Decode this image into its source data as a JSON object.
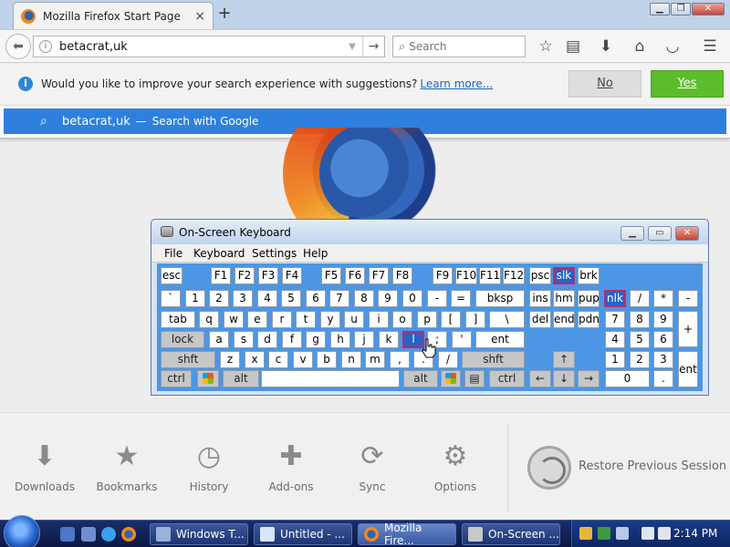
{
  "browser": {
    "tab_title": "Mozilla Firefox Start Page",
    "tab_close": "×",
    "new_tab": "+",
    "url": "betacrat,uk",
    "search_placeholder": "Search"
  },
  "notification": {
    "message": "Would you like to improve your search experience with suggestions?",
    "learn_more": "Learn more...",
    "no_label": "No",
    "yes_label": "Yes"
  },
  "suggestion": {
    "query": "betacrat,uk",
    "dash": "—",
    "action": "Search with Google"
  },
  "osk": {
    "title": "On-Screen Keyboard",
    "menu": [
      "File",
      "Keyboard",
      "Settings",
      "Help"
    ],
    "keys": {
      "esc": "esc",
      "f1": "F1",
      "f2": "F2",
      "f3": "F3",
      "f4": "F4",
      "f5": "F5",
      "f6": "F6",
      "f7": "F7",
      "f8": "F8",
      "f9": "F9",
      "f10": "F10",
      "f11": "F11",
      "f12": "F12",
      "psc": "psc",
      "slk": "slk",
      "brk": "brk",
      "backtick": "`",
      "n1": "1",
      "n2": "2",
      "n3": "3",
      "n4": "4",
      "n5": "5",
      "n6": "6",
      "n7": "7",
      "n8": "8",
      "n9": "9",
      "n0": "0",
      "minus": "-",
      "equals": "=",
      "bksp": "bksp",
      "ins": "ins",
      "hm": "hm",
      "pup": "pup",
      "nlk": "nlk",
      "np_div": "/",
      "np_mul": "*",
      "np_sub": "-",
      "tab": "tab",
      "q": "q",
      "w": "w",
      "e": "e",
      "r": "r",
      "t": "t",
      "y": "y",
      "u": "u",
      "i": "i",
      "o": "o",
      "p": "p",
      "lbracket": "[",
      "rbracket": "]",
      "backslash": "\\",
      "del": "del",
      "end": "end",
      "pdn": "pdn",
      "np7": "7",
      "np8": "8",
      "np9": "9",
      "np_add": "+",
      "lock": "lock",
      "a": "a",
      "s": "s",
      "d": "d",
      "f": "f",
      "g": "g",
      "h": "h",
      "j": "j",
      "k": "k",
      "l": "l",
      "semicolon": ";",
      "quote": "'",
      "ent": "ent",
      "np4": "4",
      "np5": "5",
      "np6": "6",
      "shft_l": "shft",
      "z": "z",
      "x": "x",
      "c": "c",
      "v": "v",
      "b": "b",
      "n": "n",
      "m": "m",
      "comma": ",",
      "period": ".",
      "slash": "/",
      "shft_r": "shft",
      "up": "↑",
      "np1": "1",
      "np2": "2",
      "np3": "3",
      "np_ent": "ent",
      "ctrl_l": "ctrl",
      "alt_l": "alt",
      "alt_r": "alt",
      "ctrl_r": "ctrl",
      "left": "←",
      "down": "↓",
      "right": "→",
      "np0": "0",
      "np_dot": "."
    }
  },
  "launcher": {
    "downloads": "Downloads",
    "bookmarks": "Bookmarks",
    "history": "History",
    "addons": "Add-ons",
    "sync": "Sync",
    "options": "Options",
    "restore": "Restore Previous Session"
  },
  "taskbar": {
    "tasks": [
      "Windows T...",
      "Untitled - ...",
      "Mozilla Fire...",
      "On-Screen ..."
    ],
    "clock": "2:14 PM"
  },
  "colors": {
    "accent_blue": "#2f7fde",
    "yes_green": "#5cbd2b",
    "osk_body": "#4d96e3",
    "osk_selected": "#2563c9",
    "osk_highlight_border": "#c0286c"
  }
}
